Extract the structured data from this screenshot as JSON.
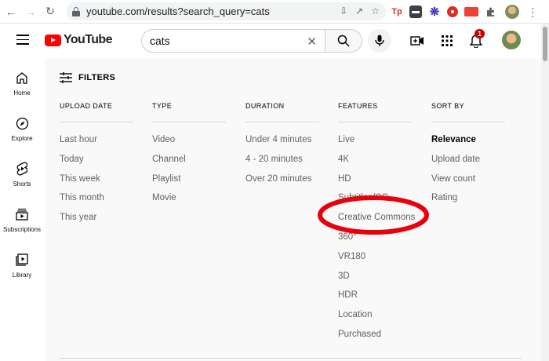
{
  "browser": {
    "url": "youtube.com/results?search_query=cats",
    "extensions": [
      {
        "name": "tp-extension-icon",
        "label": "Tp",
        "color": "#d93025"
      },
      {
        "name": "meter-extension-icon",
        "label": "",
        "color": "#3c4043"
      },
      {
        "name": "gear-extension-icon",
        "label": "",
        "color": "#4b3fbf"
      },
      {
        "name": "location-extension-icon",
        "label": "",
        "color": "#d93025"
      },
      {
        "name": "red-tag-extension-icon",
        "label": "",
        "color": "#ea4335"
      }
    ]
  },
  "header": {
    "logo_text": "YouTube",
    "search_value": "cats",
    "notification_count": "1"
  },
  "sidebar": {
    "items": [
      {
        "label": "Home"
      },
      {
        "label": "Explore"
      },
      {
        "label": "Shorts"
      },
      {
        "label": "Subscriptions"
      },
      {
        "label": "Library"
      }
    ]
  },
  "filters": {
    "title": "FILTERS",
    "columns": [
      {
        "heading": "UPLOAD DATE",
        "options": [
          "Last hour",
          "Today",
          "This week",
          "This month",
          "This year"
        ]
      },
      {
        "heading": "TYPE",
        "options": [
          "Video",
          "Channel",
          "Playlist",
          "Movie"
        ]
      },
      {
        "heading": "DURATION",
        "options": [
          "Under 4 minutes",
          "4 - 20 minutes",
          "Over 20 minutes"
        ]
      },
      {
        "heading": "FEATURES",
        "options": [
          "Live",
          "4K",
          "HD",
          "Subtitles/CC",
          "Creative Commons",
          "360°",
          "VR180",
          "3D",
          "HDR",
          "Location",
          "Purchased"
        ]
      },
      {
        "heading": "SORT BY",
        "options": [
          "Relevance",
          "Upload date",
          "View count",
          "Rating"
        ],
        "selected": "Relevance"
      }
    ]
  },
  "annotation": {
    "highlight_color": "#e8000d",
    "highlighted_option": "Creative Commons"
  },
  "colors": {
    "brand_red": "#ff0000",
    "text_secondary": "#606060",
    "background": "#f9f9f9"
  }
}
